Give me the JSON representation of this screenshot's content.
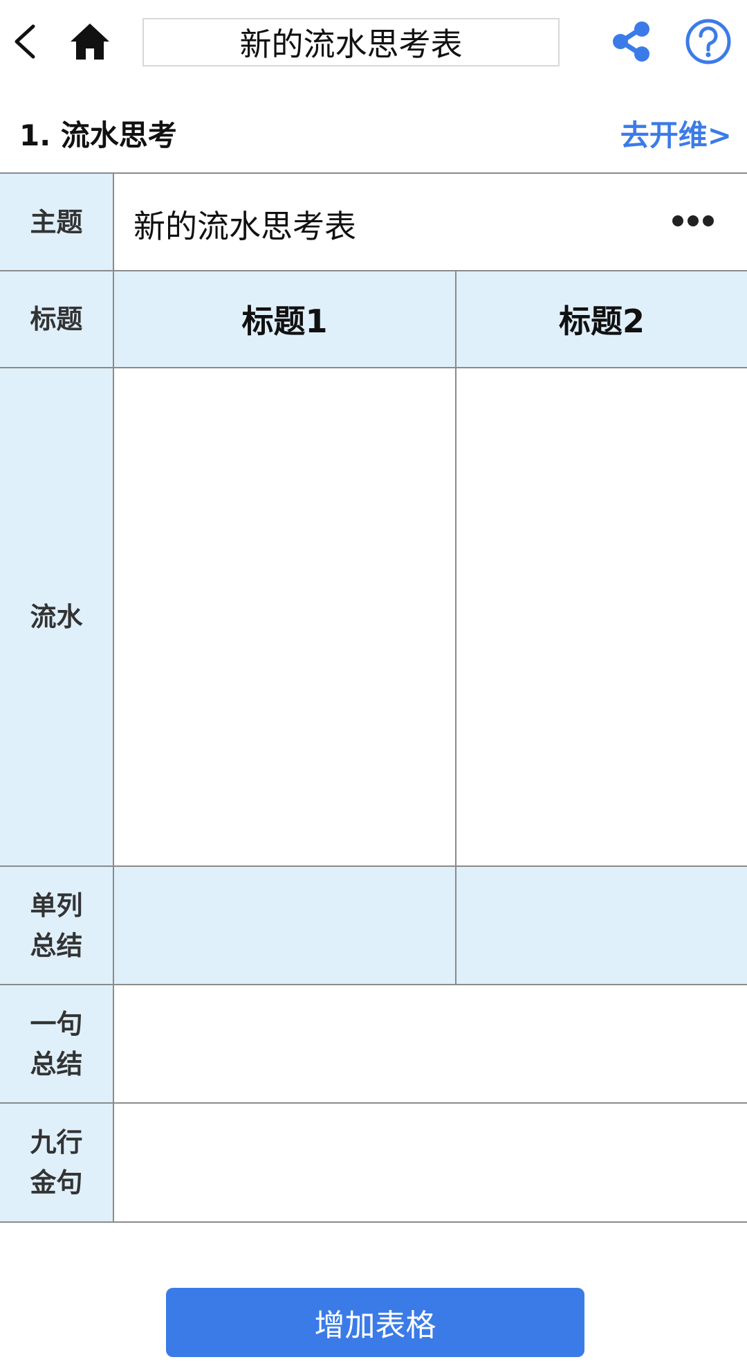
{
  "header": {
    "title": "新的流水思考表",
    "back_icon": "chevron-left-icon",
    "home_icon": "home-icon",
    "share_icon": "share-icon",
    "help_icon": "help-icon",
    "accent_color": "#3b7be8"
  },
  "section": {
    "title": "1. 流水思考",
    "link_label": "去开维>"
  },
  "table": {
    "rows": {
      "topic_label": "主题",
      "topic_value": "新的流水思考表",
      "titles_label": "标题",
      "flow_label": "流水",
      "column_summary_label": "单列总结",
      "one_sentence_label": "一句总结",
      "nine_lines_label": "九行金句"
    },
    "columns": [
      "标题1",
      "标题2"
    ],
    "more_icon": "more-horizontal-icon",
    "label_background": "#e0f0fb"
  },
  "footer": {
    "add_button_label": "增加表格"
  }
}
